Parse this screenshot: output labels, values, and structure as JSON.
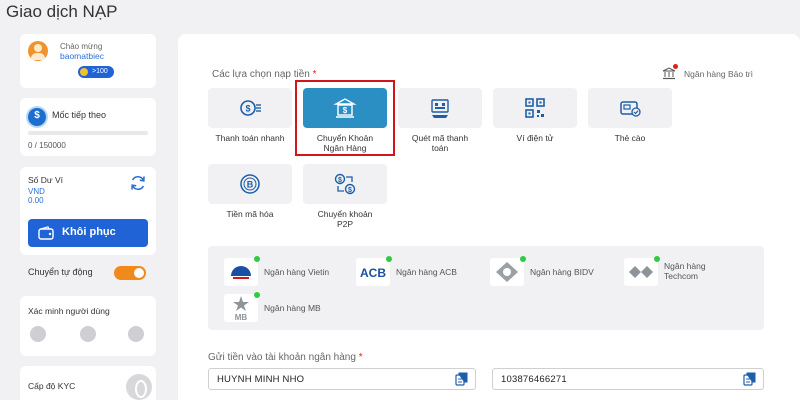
{
  "page_title": "Giao dịch NẠP",
  "sidebar": {
    "welcome": {
      "greeting": "Chào mừng",
      "username": "baomatbiec",
      "badge": ">100"
    },
    "milestone": {
      "label": "Mốc tiếp theo",
      "value_text": "0 / 150000",
      "progress": 0
    },
    "wallet": {
      "label": "Số Dư Ví",
      "currency": "VND",
      "amount": "0.00",
      "restore_label": "Khôi phục"
    },
    "auto_transfer": {
      "label": "Chuyển tự động",
      "enabled": true
    },
    "verify": {
      "label": "Xác minh người dùng"
    },
    "kyc": {
      "label": "Cấp độ KYC"
    }
  },
  "main": {
    "options_label": "Các lựa chọn nạp tiền",
    "required_mark": "*",
    "maintenance_label": "Ngân hàng Bảo trì",
    "options": [
      {
        "label_line1": "Thanh toán nhanh",
        "label_line2": "",
        "icon": "fast-payment-icon",
        "selected": false
      },
      {
        "label_line1": "Chuyển Khoản",
        "label_line2": "Ngân Hàng",
        "icon": "bank-transfer-icon",
        "selected": true
      },
      {
        "label_line1": "Quét mã thanh",
        "label_line2": "toán",
        "icon": "scan-code-icon",
        "selected": false
      },
      {
        "label_line1": "Ví điện tử",
        "label_line2": "",
        "icon": "qr-wallet-icon",
        "selected": false
      },
      {
        "label_line1": "Thẻ cào",
        "label_line2": "",
        "icon": "scratch-card-icon",
        "selected": false
      },
      {
        "label_line1": "Tiền mã hóa",
        "label_line2": "",
        "icon": "crypto-icon",
        "selected": false
      },
      {
        "label_line1": "Chuyển khoản",
        "label_line2": "P2P",
        "icon": "p2p-icon",
        "selected": false
      }
    ],
    "banks": [
      {
        "name_line1": "Ngân hàng Vietin",
        "name_line2": "",
        "logo": "vietin-logo"
      },
      {
        "name_line1": "Ngân hàng ACB",
        "name_line2": "",
        "logo": "acb-logo",
        "logo_text": "ACB"
      },
      {
        "name_line1": "Ngân hàng BIDV",
        "name_line2": "",
        "logo": "bidv-logo"
      },
      {
        "name_line1": "Ngân hàng",
        "name_line2": "Techcom",
        "logo": "techcom-logo"
      },
      {
        "name_line1": "Ngân hàng MB",
        "name_line2": "",
        "logo": "mb-logo",
        "logo_text": "MB"
      }
    ],
    "account_label": "Gửi tiền vào tài khoản ngân hàng",
    "account_name": "HUYNH MINH NHO",
    "account_number": "103876466271"
  },
  "colors": {
    "primary": "#1f63d6",
    "accent_orange": "#f08a1c",
    "selected_tile": "#2b8fc4",
    "highlight": "#d0161b",
    "online": "#2ecc40"
  }
}
